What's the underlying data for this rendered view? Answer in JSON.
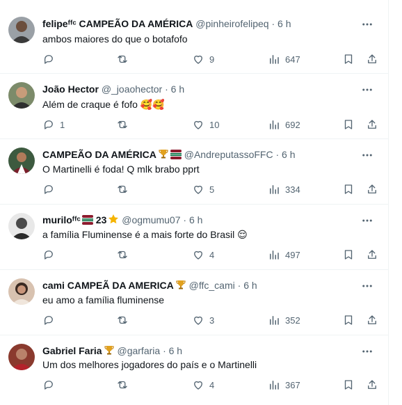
{
  "tweets": [
    {
      "name": "felipeᶠᶠᶜ CAMPEÃO DA AMÉRICA",
      "handle": "@pinheirofelipeq",
      "time": "6 h",
      "text": "ambos maiores do que o botafofo",
      "replies": "",
      "likes": "9",
      "views": "647",
      "avatar_color": "#9aa0a6",
      "badges": []
    },
    {
      "name": "João Hector",
      "handle": "@_joaohector",
      "time": "6 h",
      "text": "Além de craque é fofo 🥰🥰",
      "replies": "1",
      "likes": "10",
      "views": "692",
      "avatar_color": "#7c8b6a",
      "badges": []
    },
    {
      "name": "CAMPEÃO DA AMÉRICA",
      "handle": "@AndreputassoFFC",
      "time": "6 h",
      "text": "O Martinelli é foda! Q mlk brabo pprt",
      "replies": "",
      "likes": "5",
      "views": "334",
      "avatar_color": "#3d5a3f",
      "badges": [
        "trophy-icon",
        "fluminense-flag-icon"
      ]
    },
    {
      "name": "muriloᶠᶠᶜ",
      "handle": "@ogmumu07",
      "time": "6 h",
      "text": "a família Fluminense é a mais forte do Brasil 😌",
      "replies": "",
      "likes": "4",
      "views": "497",
      "avatar_color": "#d9d9d9",
      "badges": [
        "fluminense-flag-icon"
      ],
      "extra": "23",
      "extra_badge": "star-icon"
    },
    {
      "name": "cami CAMPEÃ DA AMERICA",
      "handle": "@ffc_cami",
      "time": "6 h",
      "text": "eu amo a família fluminense",
      "replies": "",
      "likes": "3",
      "views": "352",
      "avatar_color": "#b48a6e",
      "badges": [
        "trophy-icon"
      ]
    },
    {
      "name": "Gabriel Faria",
      "handle": "@garfaria",
      "time": "6 h",
      "text": "Um dos melhores jogadores do país e o Martinelli",
      "replies": "",
      "likes": "4",
      "views": "367",
      "avatar_color": "#8a3a2e",
      "badges": [
        "trophy-icon"
      ]
    }
  ],
  "dot": "·",
  "colors": {
    "muted": "#536471",
    "text": "#0f1419",
    "separator": "#eff3f4"
  }
}
